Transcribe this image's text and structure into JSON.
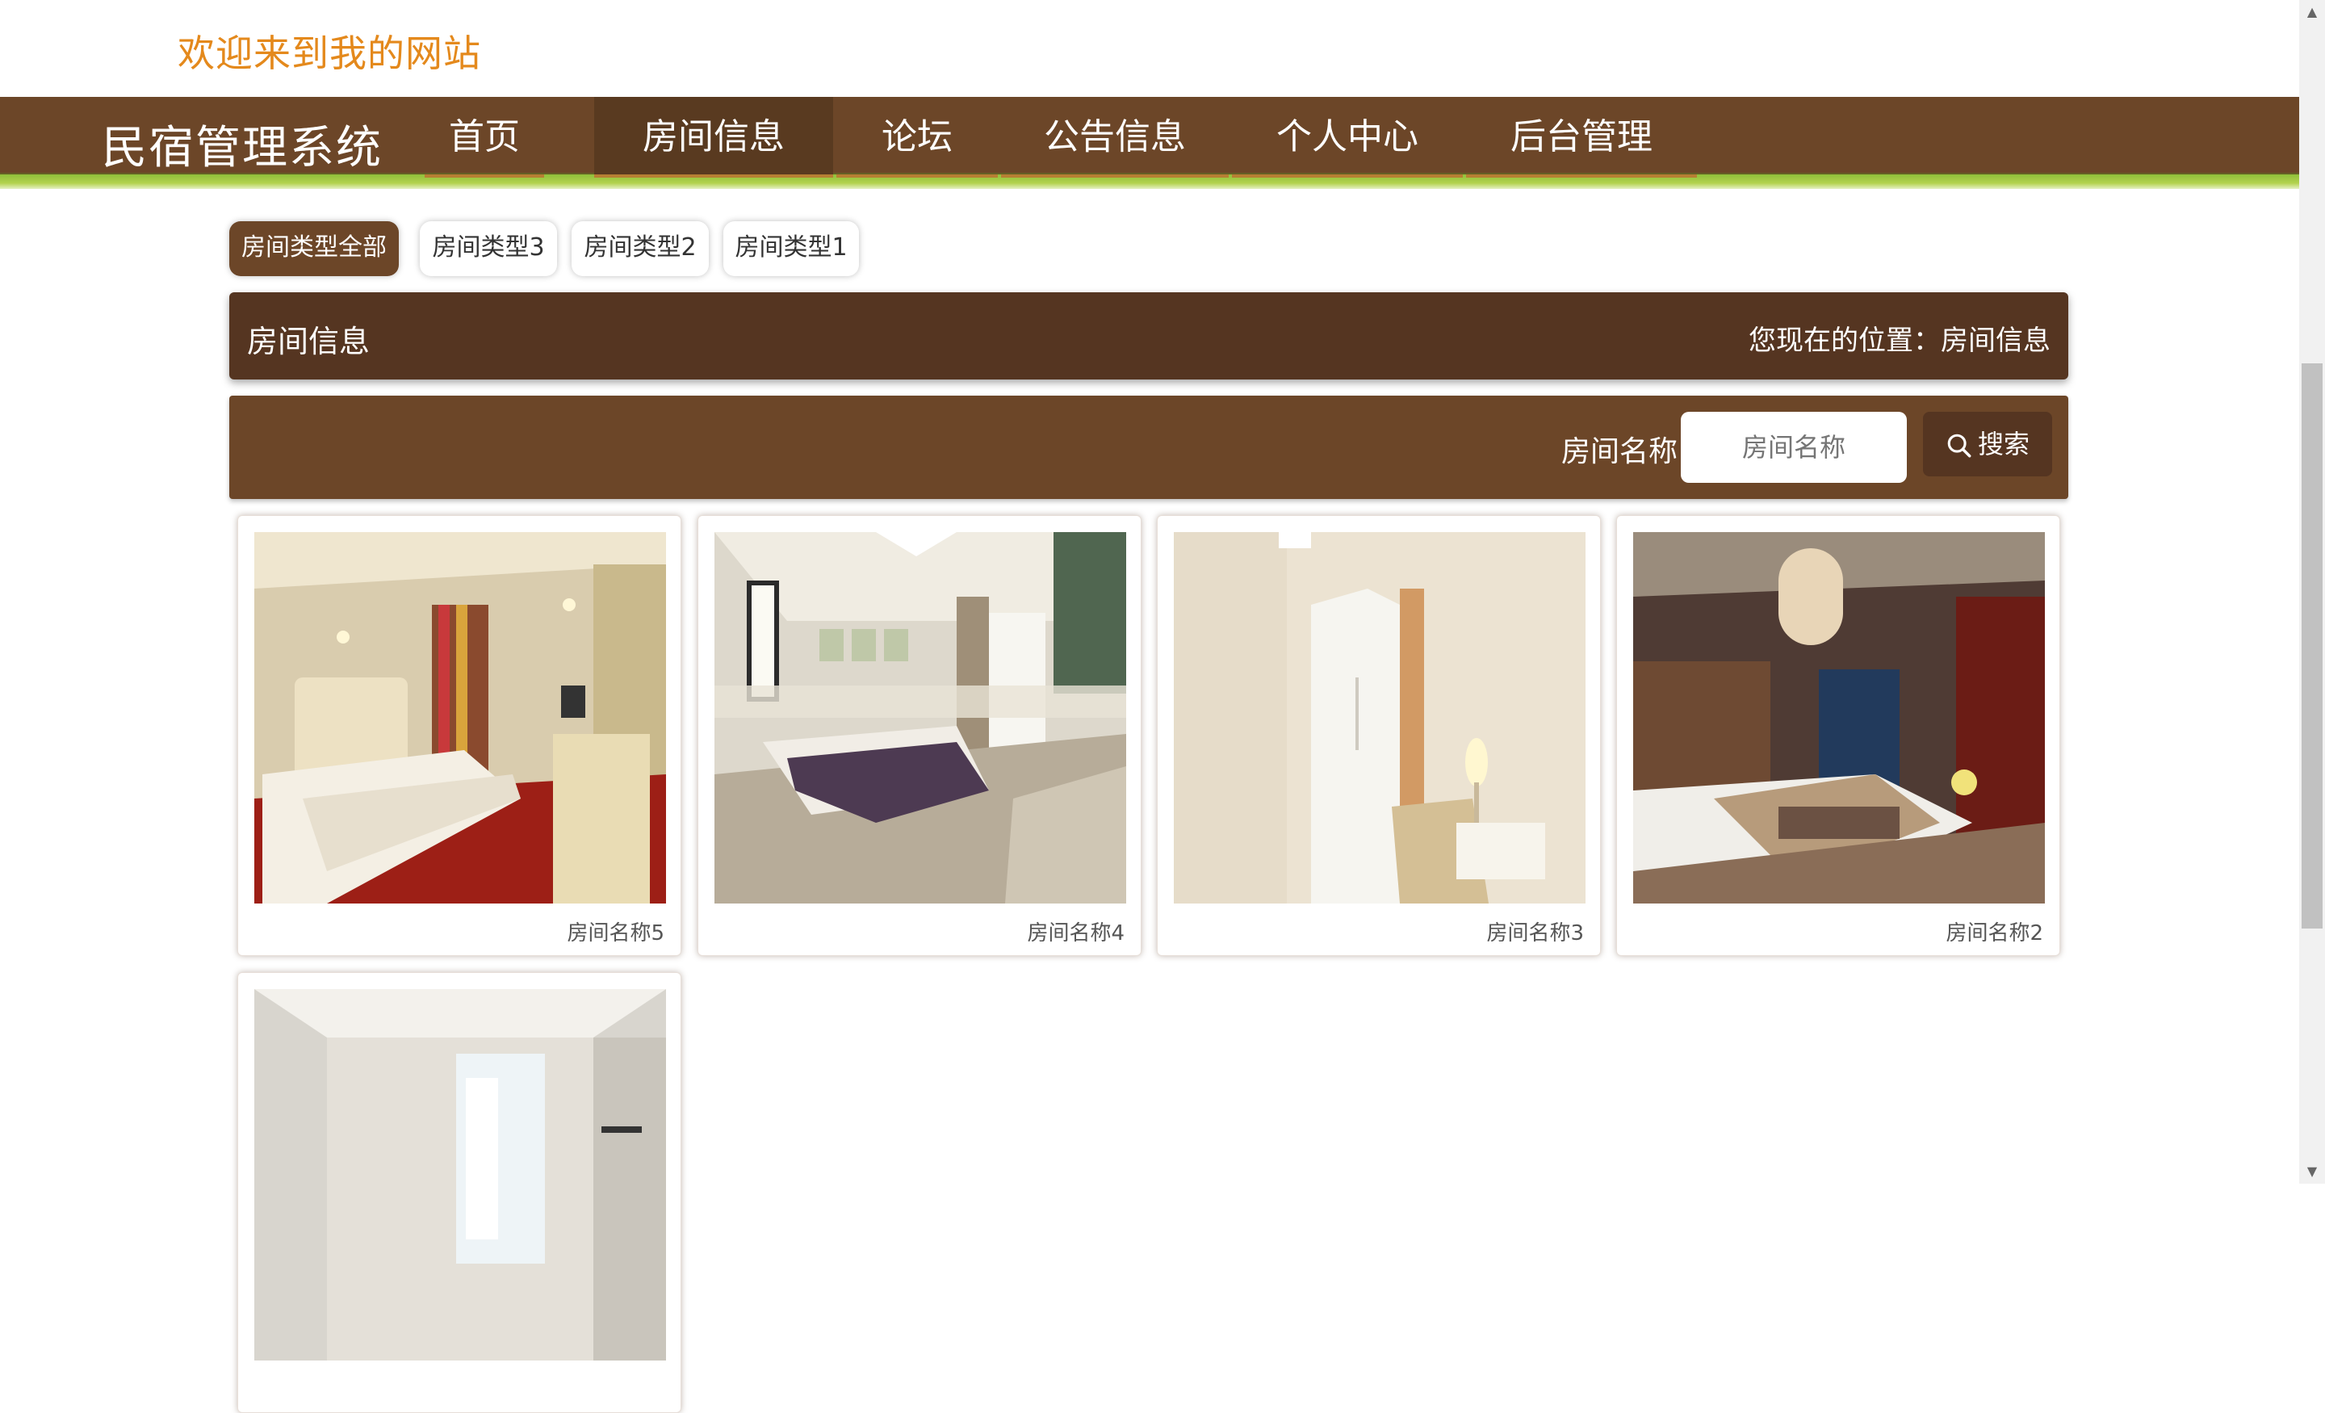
{
  "welcome_text": "欢迎来到我的网站",
  "brand": "民宿管理系统",
  "nav": {
    "items": [
      {
        "label": "首页"
      },
      {
        "label": "房间信息"
      },
      {
        "label": "论坛"
      },
      {
        "label": "公告信息"
      },
      {
        "label": "个人中心"
      },
      {
        "label": "后台管理"
      }
    ],
    "active_index": 1
  },
  "filters": {
    "chips": [
      {
        "label": "房间类型全部"
      },
      {
        "label": "房间类型3"
      },
      {
        "label": "房间类型2"
      },
      {
        "label": "房间类型1"
      }
    ],
    "active_index": 0
  },
  "breadcrumb": {
    "title": "房间信息",
    "location": "您现在的位置：房间信息"
  },
  "search": {
    "label": "房间名称",
    "placeholder": "房间名称",
    "button_label": "搜索"
  },
  "rooms": [
    {
      "name": "房间名称5"
    },
    {
      "name": "房间名称4"
    },
    {
      "name": "房间名称3"
    },
    {
      "name": "房间名称2"
    },
    {
      "name": ""
    }
  ],
  "colors": {
    "welcome": "#e4891c",
    "nav_bg": "#6c4628",
    "nav_active": "#593a20",
    "breadcrumb_bg": "#553521",
    "accent_green": "#8fbf3a"
  }
}
